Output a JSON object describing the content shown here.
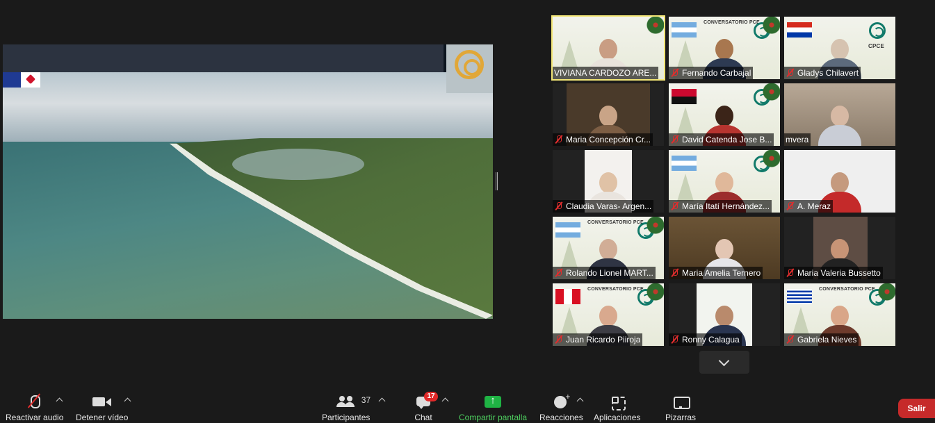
{
  "participants": [
    {
      "name": "VIVIANA CARDOZO ARE...",
      "muted": false
    },
    {
      "name": "Fernando Carbajal",
      "muted": true
    },
    {
      "name": "Gladys Chilavert",
      "muted": true
    },
    {
      "name": "Maria Concepción Cr...",
      "muted": true
    },
    {
      "name": "David Catenda Jose B...",
      "muted": true
    },
    {
      "name": "mvera",
      "muted": false
    },
    {
      "name": "Claudia Varas- Argen...",
      "muted": true
    },
    {
      "name": "María Itatí Hernández...",
      "muted": true
    },
    {
      "name": "A. Meraz",
      "muted": true
    },
    {
      "name": "Rolando Lionel MART...",
      "muted": true
    },
    {
      "name": "Maria Amelia Ternero",
      "muted": true
    },
    {
      "name": "Maria Valeria Bussetto",
      "muted": true
    },
    {
      "name": "Juan Ricardo Piiroja",
      "muted": true
    },
    {
      "name": "Ronny Calagua",
      "muted": true
    },
    {
      "name": "Gabriela Nieves",
      "muted": true
    }
  ],
  "tile_text": {
    "conversatorio": "CONVERSATORIO PCE",
    "cpce": "CPCE"
  },
  "toolbar": {
    "audio_label": "Reactivar audio",
    "video_label": "Detener vídeo",
    "participants_label": "Participantes",
    "participants_count": "37",
    "chat_label": "Chat",
    "chat_badge": "17",
    "share_label": "Compartir pantalla",
    "reactions_label": "Reacciones",
    "apps_label": "Aplicaciones",
    "whiteboard_label": "Pizarras",
    "leave_label": "Salir"
  },
  "colors": {
    "active_speaker": "#f3e676",
    "share_green": "#4ed160",
    "leave_red": "#c62a2a",
    "badge_red": "#e02828"
  }
}
